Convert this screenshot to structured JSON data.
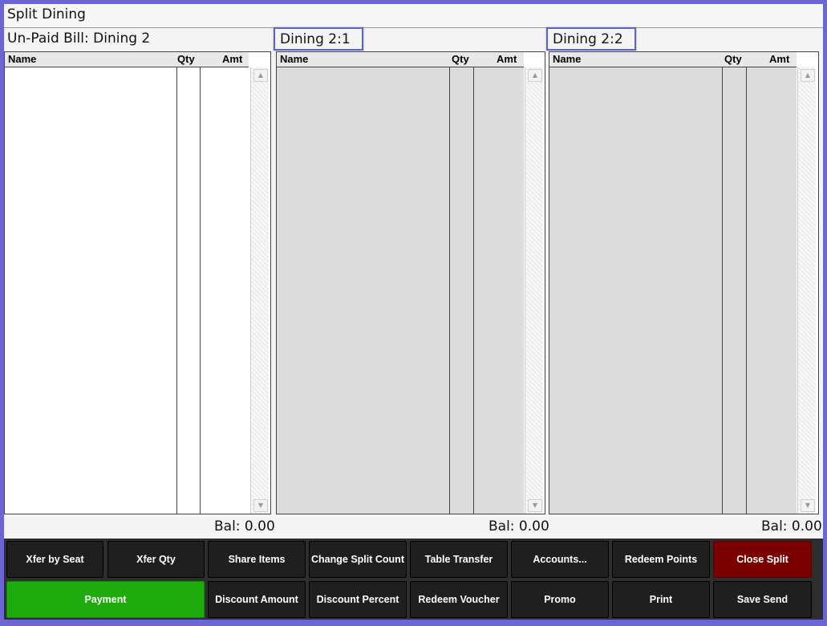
{
  "window": {
    "title": "Split Dining"
  },
  "columns_header": {
    "name": "Name",
    "qty": "Qty",
    "amt": "Amt"
  },
  "panels": [
    {
      "title": "Un-Paid Bill: Dining 2",
      "balance": "Bal: 0.00"
    },
    {
      "title": "Dining 2:1",
      "balance": "Bal: 0.00"
    },
    {
      "title": "Dining 2:2",
      "balance": "Bal: 0.00"
    }
  ],
  "buttons": {
    "row1": [
      "Xfer by Seat",
      "Xfer Qty",
      "Share Items",
      "Change Split Count",
      "Table Transfer",
      "Accounts...",
      "Redeem Points",
      "Close Split"
    ],
    "row2": [
      "Payment",
      "Discount Amount",
      "Discount Percent",
      "Redeem Voucher",
      "Promo",
      "Print",
      "Save Send"
    ]
  },
  "colors": {
    "payment": "#1eab0e",
    "close_split": "#7a0000",
    "selected_border": "#5a62d0"
  }
}
